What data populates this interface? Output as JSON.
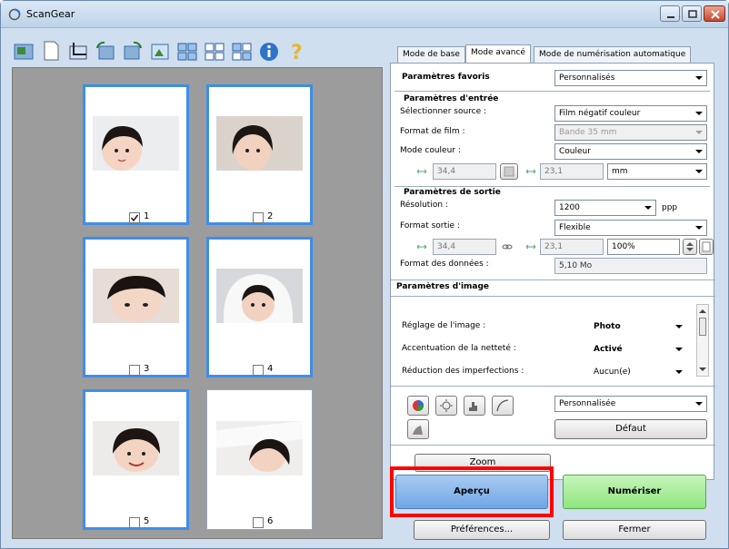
{
  "window": {
    "title": "ScanGear"
  },
  "thumbnails": [
    {
      "label": "1",
      "checked": true,
      "selected": true
    },
    {
      "label": "2",
      "checked": false,
      "selected": true
    },
    {
      "label": "3",
      "checked": false,
      "selected": true
    },
    {
      "label": "4",
      "checked": false,
      "selected": true
    },
    {
      "label": "5",
      "checked": false,
      "selected": true
    },
    {
      "label": "6",
      "checked": false,
      "selected": false
    }
  ],
  "tabs": [
    {
      "label": "Mode de base"
    },
    {
      "label": "Mode avancé"
    },
    {
      "label": "Mode de numérisation automatique"
    }
  ],
  "favorites": {
    "label": "Paramètres favoris",
    "value": "Personnalisés"
  },
  "input_settings": {
    "title": "Paramètres d'entrée",
    "source_label": "Sélectionner source :",
    "source_value": "Film négatif couleur",
    "film_format_label": "Format de film :",
    "film_format_value": "Bande 35 mm",
    "color_mode_label": "Mode couleur :",
    "color_mode_value": "Couleur",
    "width": "34,4",
    "height": "23,1",
    "unit": "mm"
  },
  "output_settings": {
    "title": "Paramètres de sortie",
    "resolution_label": "Résolution :",
    "resolution_value": "1200",
    "resolution_unit": "ppp",
    "output_size_label": "Format sortie :",
    "output_size_value": "Flexible",
    "width": "34,4",
    "height": "23,1",
    "scale": "100%",
    "data_size_label": "Format des données :",
    "data_size_value": "5,10 Mo"
  },
  "image_settings": {
    "title": "Paramètres d'image",
    "items": [
      {
        "label": "Réglage de l'image :",
        "value": "Photo"
      },
      {
        "label": "Accentuation de la netteté :",
        "value": "Activé"
      },
      {
        "label": "Réduction des imperfections :",
        "value": "Aucun(e)"
      }
    ]
  },
  "color_adjust": {
    "preset": "Personnalisée",
    "default_label": "Défaut"
  },
  "buttons": {
    "zoom": "Zoom",
    "preview": "Aperçu",
    "scan": "Numériser",
    "preferences": "Préférences...",
    "close": "Fermer"
  },
  "colors": {
    "selection": "#3e8ee9",
    "preview_button": "#6fa7e5",
    "scan_button": "#8fe67e",
    "highlight": "#ff0000"
  }
}
